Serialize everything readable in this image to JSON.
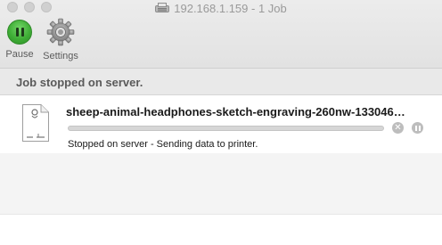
{
  "window": {
    "title": "192.168.1.159 - 1 Job"
  },
  "toolbar": {
    "pause_label": "Pause",
    "settings_label": "Settings"
  },
  "status": {
    "message": "Job stopped on server."
  },
  "job": {
    "name": "sheep-animal-headphones-sketch-engraving-260nw-133046…",
    "progress_percent": 0,
    "status_text": "Stopped on server - Sending data to printer."
  },
  "colors": {
    "pause_green": "#3fae36",
    "toolbar_bg": "#e2e2e2",
    "status_strip_bg": "#e9e9e9",
    "title_gray": "#9a9a9a"
  },
  "icons": {
    "window_title": "printer-icon",
    "pause": "pause-icon",
    "settings": "gear-icon",
    "document": "document-icon",
    "stop": "close-icon",
    "hold": "pause-circle-icon"
  }
}
